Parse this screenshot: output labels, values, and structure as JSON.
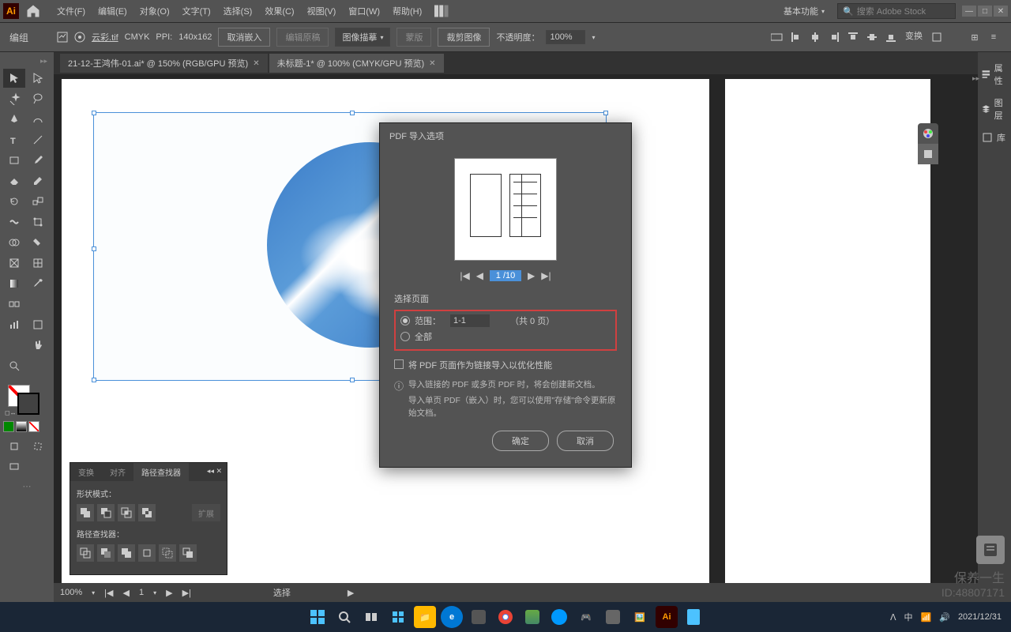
{
  "titlebar": {
    "logo": "Ai",
    "menus": [
      "文件(F)",
      "编辑(E)",
      "对象(O)",
      "文字(T)",
      "选择(S)",
      "效果(C)",
      "视图(V)",
      "窗口(W)",
      "帮助(H)"
    ],
    "workspace": "基本功能",
    "search_placeholder": "搜索 Adobe Stock"
  },
  "controlbar": {
    "mode": "编组",
    "filename": "云彩.tif",
    "colormode": "CMYK",
    "ppi_label": "PPI:",
    "ppi": "140x162",
    "cancel_embed": "取消嵌入",
    "image_desc": "图像描摹",
    "crop": "裁剪图像",
    "opacity_label": "不透明度：",
    "opacity": "100%",
    "transform": "变换"
  },
  "tabs": [
    {
      "label": "21-12-王鸿伟-01.ai* @ 150% (RGB/GPU 预览)",
      "active": false
    },
    {
      "label": "未标题-1* @ 100% (CMYK/GPU 预览)",
      "active": true
    }
  ],
  "right_panel": [
    {
      "icon": "properties",
      "label": "属性"
    },
    {
      "icon": "layers",
      "label": "图层"
    },
    {
      "icon": "library",
      "label": "库"
    }
  ],
  "dialog": {
    "title": "PDF 导入选项",
    "page_input": "1 /10",
    "section_label": "选择页面",
    "range_label": "范围：",
    "range_value": "1-1",
    "total_pages": "（共 0 页）",
    "all_label": "全部",
    "checkbox_label": "将 PDF 页面作为链接导入以优化性能",
    "info_line1": "导入链接的 PDF 或多页 PDF 时，将会创建新文档。",
    "info_line2": "导入单页 PDF（嵌入）时，您可以使用\"存储\"命令更新原始文档。",
    "ok": "确定",
    "cancel": "取消"
  },
  "pathfinder": {
    "tabs": [
      "变换",
      "对齐",
      "路径查找器"
    ],
    "shape_mode": "形状模式：",
    "expand": "扩展",
    "pathfinder_label": "路径查找器："
  },
  "statusbar": {
    "zoom": "100%",
    "page": "1",
    "select": "选择"
  },
  "watermark": {
    "brand": "保养一生",
    "id": "ID:48807171"
  },
  "taskbar": {
    "time": "2021/12/31"
  }
}
